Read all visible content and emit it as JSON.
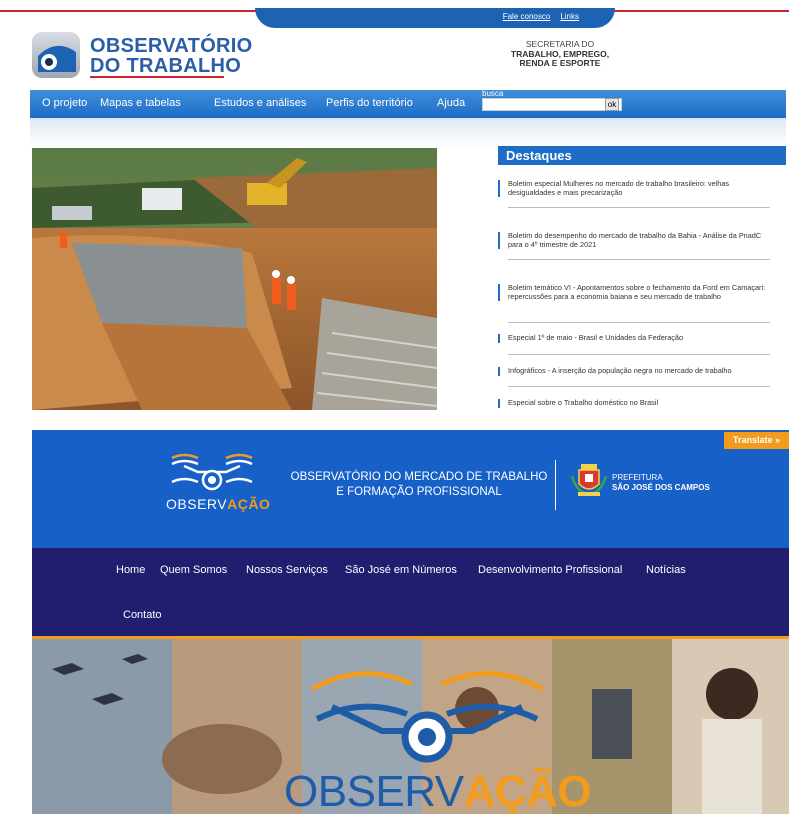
{
  "top_site": {
    "top_links": [
      "Fale conosco",
      "Links"
    ],
    "logo_line1": "OBSERVATÓRIO",
    "logo_line2": "DO TRABALHO",
    "secretaria": {
      "line1": "SECRETARIA DO",
      "line2": "TRABALHO, EMPREGO,",
      "line3": "RENDA E ESPORTE"
    },
    "nav": [
      "O projeto",
      "Mapas e tabelas",
      "Estudos e análises",
      "Perfis do território",
      "Ajuda"
    ],
    "search": {
      "label": "busca",
      "value": "",
      "button": "ok"
    },
    "destaques": {
      "title": "Destaques",
      "items": [
        "Boletim especial Mulheres no mercado de trabalho brasileiro: velhas desigualdades e mais precarização",
        "Boletim do desempenho do mercado de trabalho da Bahia - Análise da PnadC para o 4º trimestre de 2021",
        "Boletim temático VI - Apontamentos sobre o fechamento da Ford em Camaçari: repercussões para a economia baiana e seu mercado de trabalho",
        "Especial 1º de maio - Brasil e Unidades da Federação",
        "Infográficos - A inserção da população negra no mercado de trabalho",
        "Especial sobre o Trabalho doméstico no Brasil"
      ]
    }
  },
  "bottom_site": {
    "translate": "Translate »",
    "logo_word_a": "OBSERV",
    "logo_word_b": "AÇÃO",
    "title_line1": "OBSERVATÓRIO DO MERCADO DE TRABALHO",
    "title_line2": "E FORMAÇÃO PROFISSIONAL",
    "prefeitura_line1": "PREFEITURA",
    "prefeitura_line2": "SÃO JOSÉ DOS CAMPOS",
    "nav": [
      "Home",
      "Quem Somos",
      "Nossos Serviços",
      "São José em Números",
      "Desenvolvimento Profissional",
      "Notícias",
      "Contato"
    ],
    "hero_word_a": "OBSERV",
    "hero_word_b": "AÇÃO"
  },
  "colors": {
    "brand_blue": "#1d6cc5",
    "brand_red": "#c8262e",
    "nav_dark": "#211e6f",
    "accent_orange": "#f29b1c"
  }
}
